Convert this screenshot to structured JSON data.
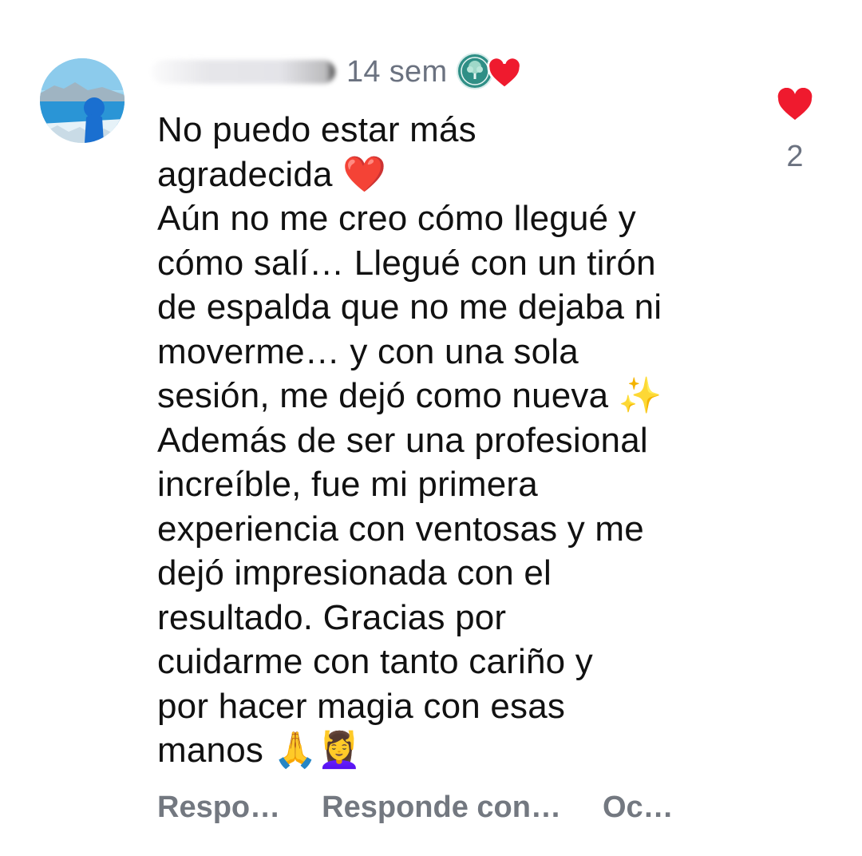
{
  "comment": {
    "timestamp": "14 sem",
    "text": "No puedo estar más\nagradecida ❤️\nAún no me creo cómo llegué y\ncómo salí… Llegué con un tirón\nde espalda que no me dejaba ni\nmoverme… y con una sola\nsesión, me dejó como nueva ✨\nAdemás de ser una profesional\nincreíble, fue mi primera\nexperiencia con ventosas y me\ndejó impresionada con el\nresultado. Gracias por\ncuidarme con tanto cariño y\npor hacer magia con esas\nmanos 🙏💆‍♀️",
    "like_count": "2",
    "actions": {
      "reply": "Respo…",
      "reply_with": "Responde con…",
      "hide": "Oc…"
    }
  },
  "icons": {
    "avatar": "avatar-photo",
    "creator_badge": "creator-logo-icon",
    "creator_heart": "heart-icon",
    "like": "heart-icon"
  },
  "colors": {
    "heart": "#ef1a2e",
    "meta_text": "#6b7280",
    "action_text": "#737880",
    "body_text": "#111111"
  }
}
